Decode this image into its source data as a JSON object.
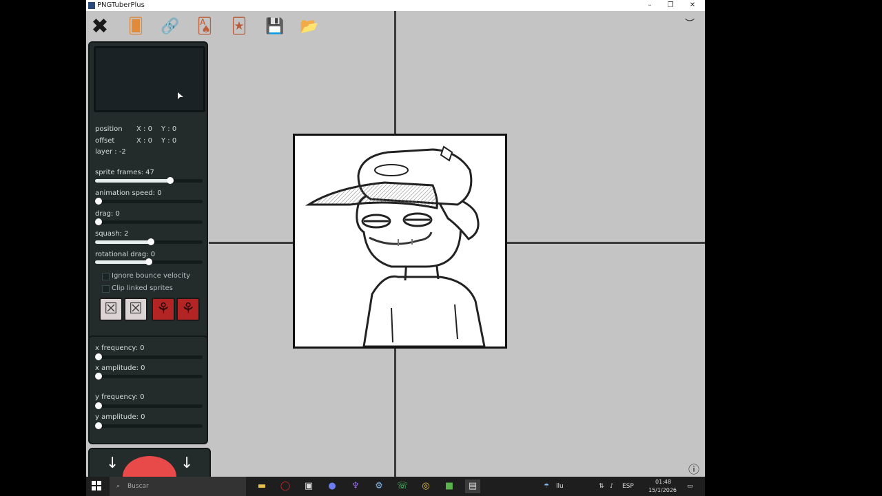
{
  "window": {
    "title": "PNGTuberPlus",
    "minimize": "–",
    "maximize": "❐",
    "close": "✕"
  },
  "toolbar": {
    "items": [
      {
        "name": "exit-button",
        "icon": "✖"
      },
      {
        "name": "add-sprite-button",
        "icon": "🂠"
      },
      {
        "name": "link-sprite-button",
        "icon": "🔗"
      },
      {
        "name": "costumes-button",
        "icon": "🂡"
      },
      {
        "name": "sprite-card-button",
        "icon": "🃏"
      },
      {
        "name": "save-button",
        "icon": "💾"
      },
      {
        "name": "load-button",
        "icon": "📂"
      }
    ],
    "collapse_icon": "︶"
  },
  "sprite_panel": {
    "position_label": "position",
    "position_x": "X : 0",
    "position_y": "Y : 0",
    "offset_label": "offset",
    "offset_x": "X : 0",
    "offset_y": "Y : 0",
    "layer": "layer : -2",
    "sliders": [
      {
        "label": "sprite frames: 47",
        "fraction": 0.7
      },
      {
        "label": "animation speed: 0",
        "fraction": 0.0
      },
      {
        "label": "drag: 0",
        "fraction": 0.0
      },
      {
        "label": "squash: 2",
        "fraction": 0.52
      },
      {
        "label": "rotational drag: 0",
        "fraction": 0.5
      }
    ],
    "checkboxes": [
      "Ignore bounce velocity",
      "Clip linked sprites"
    ],
    "action_buttons": [
      "☒",
      "☒",
      "⚘",
      "⚘"
    ]
  },
  "wobble_panel": {
    "sliders": [
      {
        "label": "x frequency: 0",
        "fraction": 0.0
      },
      {
        "label": "x amplitude: 0",
        "fraction": 0.0
      },
      {
        "label": "y frequency: 0",
        "fraction": 0.0
      },
      {
        "label": "y amplitude: 0",
        "fraction": 0.0
      }
    ]
  },
  "layer_panel": {
    "down_left": "↓",
    "down_right": "↓"
  },
  "info_icon": "ⓘ",
  "taskbar": {
    "search_placeholder": "Buscar",
    "weather": "llu",
    "lang": "ESP",
    "time": "01:48",
    "date": "15/1/2026"
  }
}
